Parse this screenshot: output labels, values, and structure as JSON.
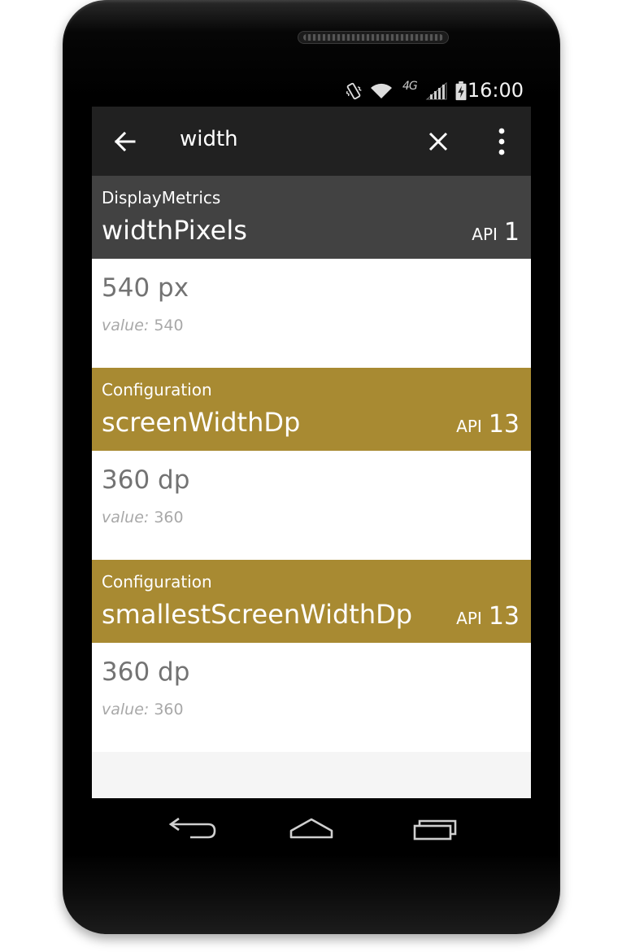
{
  "status_bar": {
    "time": "16:00",
    "network_label": "4G"
  },
  "toolbar": {
    "search_query": "width",
    "icons": [
      "back-arrow-icon",
      "close-icon",
      "overflow-menu-icon"
    ]
  },
  "results": [
    {
      "class_name": "DisplayMetrics",
      "field": "widthPixels",
      "api_label": "API",
      "api_level": "1",
      "header_color": "#424242",
      "display_value": "540 px",
      "raw_label": "value:",
      "raw_value": "540"
    },
    {
      "class_name": "Configuration",
      "field": "screenWidthDp",
      "api_label": "API",
      "api_level": "13",
      "header_color": "#a88a32",
      "display_value": "360 dp",
      "raw_label": "value:",
      "raw_value": "360"
    },
    {
      "class_name": "Configuration",
      "field": "smallestScreenWidthDp",
      "api_label": "API",
      "api_level": "13",
      "header_color": "#a88a32",
      "display_value": "360 dp",
      "raw_label": "value:",
      "raw_value": "360"
    }
  ],
  "nav_bar": {
    "icons": [
      "nav-back-icon",
      "nav-home-icon",
      "nav-recents-icon"
    ]
  },
  "colors": {
    "toolbar_bg": "#212121",
    "dark_header": "#424242",
    "gold_header": "#a88a32",
    "screen_bg": "#f5f5f5"
  }
}
